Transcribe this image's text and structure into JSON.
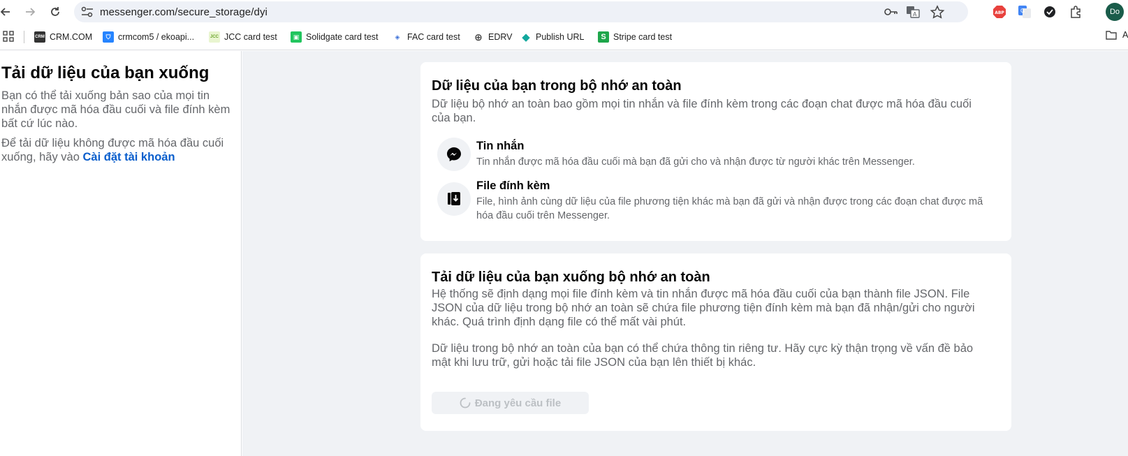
{
  "browser": {
    "url": "messenger.com/secure_storage/dyi",
    "avatar_initials": "Do",
    "bookmarks": [
      {
        "label": "CRM.COM",
        "icon": "crm-icon"
      },
      {
        "label": "crmcom5 / ekoapi...",
        "icon": "bitbucket-icon"
      },
      {
        "label": "JCC card test",
        "icon": "jcc-icon"
      },
      {
        "label": "Solidgate card test",
        "icon": "solidgate-icon"
      },
      {
        "label": "FAC card test",
        "icon": "fac-icon"
      },
      {
        "label": "EDRV",
        "icon": "globe-icon"
      },
      {
        "label": "Publish URL",
        "icon": "diamond-icon"
      },
      {
        "label": "Stripe card test",
        "icon": "stripe-icon"
      }
    ],
    "folder_label": "A"
  },
  "sidebar": {
    "title": "Tải dữ liệu của bạn xuống",
    "description": "Bạn có thể tải xuống bản sao của mọi tin nhắn được mã hóa đầu cuối và file đính kèm bất cứ lúc nào.",
    "note_prefix": "Để tải dữ liệu không được mã hóa đầu cuối xuống, hãy vào ",
    "note_link": "Cài đặt tài khoản"
  },
  "card_storage": {
    "title": "Dữ liệu của bạn trong bộ nhớ an toàn",
    "description": "Dữ liệu bộ nhớ an toàn bao gồm mọi tin nhắn và file đính kèm trong các đoạn chat được mã hóa đầu cuối của bạn.",
    "items": [
      {
        "title": "Tin nhắn",
        "description": "Tin nhắn được mã hóa đầu cuối mà bạn đã gửi cho và nhận được từ người khác trên Messenger."
      },
      {
        "title": "File đính kèm",
        "description": "File, hình ảnh cùng dữ liệu của file phương tiện khác mà bạn đã gửi và nhận được trong các đoạn chat được mã hóa đầu cuối trên Messenger."
      }
    ]
  },
  "card_download": {
    "title": "Tải dữ liệu của bạn xuống bộ nhớ an toàn",
    "description": "Hệ thống sẽ định dạng mọi file đính kèm và tin nhắn được mã hóa đầu cuối của bạn thành file JSON. File JSON của dữ liệu trong bộ nhớ an toàn sẽ chứa file phương tiện đính kèm mà bạn đã nhận/gửi cho người khác. Quá trình định dạng file có thể mất vài phút.",
    "warning": "Dữ liệu trong bộ nhớ an toàn của bạn có thể chứa thông tin riêng tư. Hãy cực kỳ thận trọng về vấn đề bảo mật khi lưu trữ, gửi hoặc tải file JSON của bạn lên thiết bị khác.",
    "button_label": "Đang yêu cầu file"
  }
}
